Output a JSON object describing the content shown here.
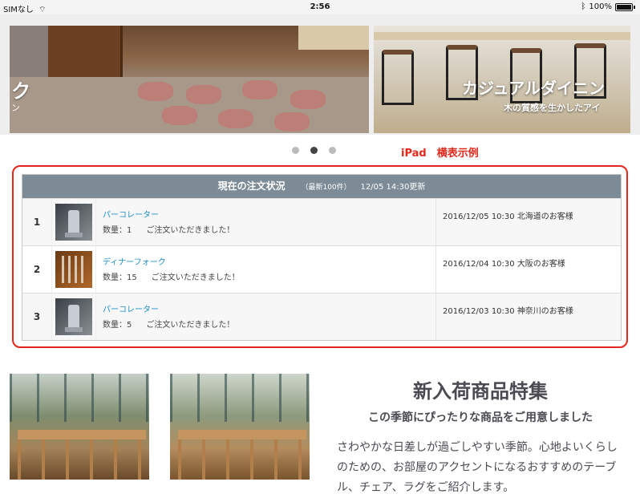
{
  "status_bar": {
    "carrier": "SIMなし",
    "time": "2:56",
    "battery": "100%"
  },
  "hero": {
    "left_caption": "ク",
    "left_sub": "ン",
    "right_caption": "カジュアルダイニン",
    "right_sub": "木の質感を生かしたアイ"
  },
  "carousel": {
    "dots": 3,
    "active": 2
  },
  "annotation": "iPad　横表示例",
  "orders": {
    "title": "現在の注文状況",
    "meta": "（最新100件）",
    "updated": "12/05 14:30更新",
    "rows": [
      {
        "rank": "1",
        "thumb": "coffee-maker",
        "name": "パーコレーター",
        "qty": "数量：1",
        "msg": "ご注文いただきました！",
        "date": "2016/12/05 10:30 北海道のお客様"
      },
      {
        "rank": "2",
        "thumb": "fork",
        "name": "ディナーフォーク",
        "qty": "数量：15",
        "msg": "ご注文いただきました！",
        "date": "2016/12/04 10:30 大阪のお客様"
      },
      {
        "rank": "3",
        "thumb": "coffee-maker",
        "name": "パーコレーター",
        "qty": "数量：5",
        "msg": "ご注文いただきました！",
        "date": "2016/12/03 10:30 神奈川のお客様"
      }
    ]
  },
  "feature": {
    "title": "新入荷商品特集",
    "subtitle": "この季節にぴったりな商品をご用意しました",
    "body": "さわやかな日差しが過ごしやすい季節。心地よいくらしのための、お部屋のアクセントになるおすすめのテーブル、チェア、ラグをご紹介します。"
  }
}
